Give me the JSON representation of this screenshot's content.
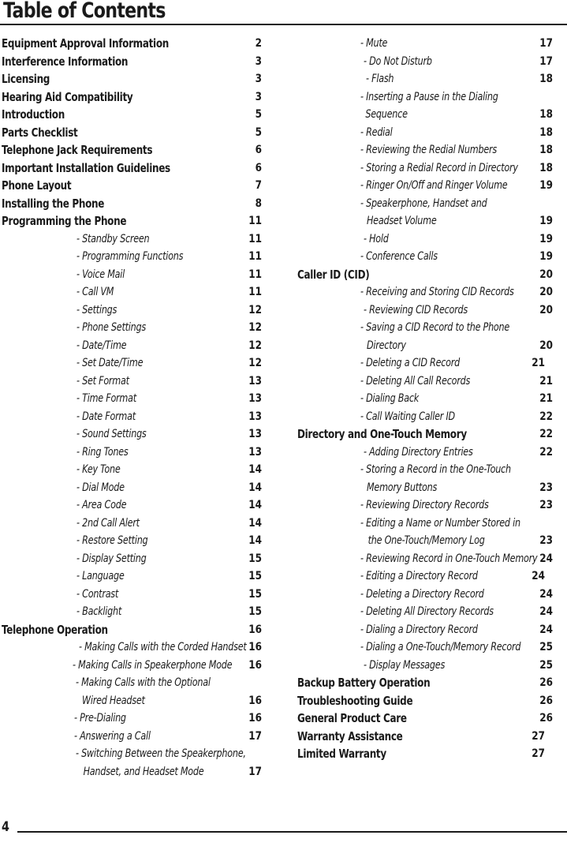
{
  "document": {
    "title": "Table of Contents",
    "folio": "4"
  },
  "columns": [
    {
      "id": "left",
      "entries": [
        {
          "type": "section",
          "label": "Equipment Approval Information",
          "page": "2",
          "indent": 0
        },
        {
          "type": "section",
          "label": "Interference Information",
          "page": "3",
          "indent": 0
        },
        {
          "type": "section",
          "label": "Licensing",
          "page": "3",
          "indent": 0
        },
        {
          "type": "section",
          "label": "Hearing Aid Compatibility",
          "page": "3",
          "indent": 0
        },
        {
          "type": "section",
          "label": "Introduction",
          "page": "5",
          "indent": 0
        },
        {
          "type": "section",
          "label": "Parts Checklist",
          "page": "5",
          "indent": 0
        },
        {
          "type": "section",
          "label": "Telephone Jack Requirements",
          "page": "6",
          "indent": 0
        },
        {
          "type": "section",
          "label": "Important Installation Guidelines",
          "page": "6",
          "indent": 0
        },
        {
          "type": "section",
          "label": "Phone Layout",
          "page": "7",
          "indent": 0
        },
        {
          "type": "section",
          "label": "Installing the Phone",
          "page": "8",
          "indent": 0
        },
        {
          "type": "section",
          "label": "Programming the Phone",
          "page": "11",
          "indent": 0
        },
        {
          "type": "sub",
          "label": "- Standby Screen",
          "page": "11",
          "indent": 95
        },
        {
          "type": "sub",
          "label": "- Programming Functions",
          "page": "11",
          "indent": 95
        },
        {
          "type": "sub",
          "label": "- Voice Mail",
          "page": "11",
          "indent": 95
        },
        {
          "type": "sub",
          "label": "- Call VM",
          "page": "11",
          "indent": 95
        },
        {
          "type": "sub",
          "label": "- Settings",
          "page": "12",
          "indent": 95
        },
        {
          "type": "sub",
          "label": "- Phone Settings",
          "page": "12",
          "indent": 95
        },
        {
          "type": "sub",
          "label": "- Date/Time",
          "page": "12",
          "indent": 95
        },
        {
          "type": "sub",
          "label": "- Set Date/Time",
          "page": "12",
          "indent": 95
        },
        {
          "type": "sub",
          "label": "- Set Format",
          "page": "13",
          "indent": 95
        },
        {
          "type": "sub",
          "label": "- Time Format",
          "page": "13",
          "indent": 95
        },
        {
          "type": "sub",
          "label": "- Date Format",
          "page": "13",
          "indent": 95
        },
        {
          "type": "sub",
          "label": "- Sound Settings",
          "page": "13",
          "indent": 95
        },
        {
          "type": "sub",
          "label": "- Ring Tones",
          "page": "13",
          "indent": 95
        },
        {
          "type": "sub",
          "label": "- Key Tone",
          "page": "14",
          "indent": 95
        },
        {
          "type": "sub",
          "label": "- Dial Mode",
          "page": "14",
          "indent": 95
        },
        {
          "type": "sub",
          "label": "- Area Code",
          "page": "14",
          "indent": 95
        },
        {
          "type": "sub",
          "label": "- 2nd Call Alert",
          "page": "14",
          "indent": 95
        },
        {
          "type": "sub",
          "label": "- Restore Setting",
          "page": "14",
          "indent": 95
        },
        {
          "type": "sub",
          "label": "- Display Setting",
          "page": "15",
          "indent": 95
        },
        {
          "type": "sub",
          "label": "- Language",
          "page": "15",
          "indent": 95
        },
        {
          "type": "sub",
          "label": "- Contrast",
          "page": "15",
          "indent": 95
        },
        {
          "type": "sub",
          "label": "- Backlight",
          "page": "15",
          "indent": 95
        },
        {
          "type": "section",
          "label": "Telephone Operation",
          "page": "16",
          "indent": 0
        },
        {
          "type": "sub",
          "label": "- Making Calls with the Corded Handset",
          "page": "16",
          "indent": 98
        },
        {
          "type": "sub",
          "label": "- Making Calls in Speakerphone  Mode",
          "page": "16",
          "indent": 90
        },
        {
          "type": "sub",
          "label": "- Making Calls with the Optional",
          "label2": "Wired Headset",
          "page": "16",
          "indent": 94,
          "indent2": 104
        },
        {
          "type": "sub",
          "label": "- Pre-Dialing",
          "page": "16",
          "indent": 92
        },
        {
          "type": "sub",
          "label": "- Answering a Call",
          "page": "17",
          "indent": 92
        },
        {
          "type": "sub",
          "label": "- Switching Between the Speakerphone,",
          "label2": "Handset, and Headset Mode",
          "page": "17",
          "indent": 94,
          "indent2": 106
        }
      ]
    },
    {
      "id": "right",
      "entries": [
        {
          "type": "sub",
          "label": "- Mute",
          "page": "17",
          "indent": 88
        },
        {
          "type": "sub",
          "label": "- Do Not Disturb",
          "page": "17",
          "indent": 92
        },
        {
          "type": "sub",
          "label": "- Flash",
          "page": "18",
          "indent": 95
        },
        {
          "type": "sub",
          "label": "- Inserting a Pause in the Dialing",
          "label2": "Sequence",
          "page": "18",
          "indent": 88,
          "indent2": 96
        },
        {
          "type": "sub",
          "label": "- Redial",
          "page": "18",
          "indent": 88
        },
        {
          "type": "sub",
          "label": "- Reviewing the Redial Numbers",
          "page": "18",
          "indent": 88
        },
        {
          "type": "sub",
          "label": "- Storing a Redial Record in Directory",
          "page": "18",
          "indent": 88
        },
        {
          "type": "sub",
          "label": "- Ringer On/Off and Ringer Volume",
          "page": "19",
          "indent": 88
        },
        {
          "type": "sub",
          "label": "- Speakerphone, Handset and",
          "label2": "Headset Volume",
          "page": "19",
          "indent": 88,
          "indent2": 98
        },
        {
          "type": "sub",
          "label": "- Hold",
          "page": "19",
          "indent": 92
        },
        {
          "type": "sub",
          "label": "- Conference Calls",
          "page": "19",
          "indent": 88
        },
        {
          "type": "section",
          "label": "Caller ID (CID)",
          "page": "20",
          "indent": 8
        },
        {
          "type": "sub",
          "label": "- Receiving and Storing CID Records",
          "page": "20",
          "indent": 88
        },
        {
          "type": "sub",
          "label": "- Reviewing CID Records",
          "page": "20",
          "indent": 92
        },
        {
          "type": "sub",
          "label": "- Saving a CID Record to the Phone",
          "label2": "Directory",
          "page": "20",
          "indent": 88,
          "indent2": 98
        },
        {
          "type": "sub",
          "label": "- Deleting a CID Record",
          "page": "21",
          "indent": 88,
          "pagenudge": true
        },
        {
          "type": "sub",
          "label": "- Deleting All Call Records",
          "page": "21",
          "indent": 88
        },
        {
          "type": "sub",
          "label": "- Dialing Back",
          "page": "21",
          "indent": 88
        },
        {
          "type": "sub",
          "label": "- Call Waiting Caller ID",
          "page": "22",
          "indent": 88
        },
        {
          "type": "section",
          "label": "Directory and One-Touch Memory",
          "page": "22",
          "indent": 8
        },
        {
          "type": "sub",
          "label": "- Adding Directory Entries",
          "page": "22",
          "indent": 92
        },
        {
          "type": "sub",
          "label": "- Storing a Record in the One-Touch",
          "label2": "Memory Buttons",
          "page": "23",
          "indent": 88,
          "indent2": 98
        },
        {
          "type": "sub",
          "label": "- Reviewing Directory Records",
          "page": "23",
          "indent": 88
        },
        {
          "type": "sub",
          "label": "- Editing a Name or Number Stored in",
          "label2": "the One-Touch/Memory Log",
          "page": "23",
          "indent": 88,
          "indent2": 100
        },
        {
          "type": "sub",
          "label": "- Reviewing Record in One-Touch Memory",
          "page": "24",
          "indent": 88
        },
        {
          "type": "sub",
          "label": "- Editing a Directory Record",
          "page": "24",
          "indent": 88,
          "pagenudge": true
        },
        {
          "type": "sub",
          "label": "- Deleting a Directory Record",
          "page": "24",
          "indent": 88
        },
        {
          "type": "sub",
          "label": "- Deleting All Directory Records",
          "page": "24",
          "indent": 88
        },
        {
          "type": "sub",
          "label": "- Dialing a Directory Record",
          "page": "24",
          "indent": 88
        },
        {
          "type": "sub",
          "label": "- Dialing a One-Touch/Memory Record",
          "page": "25",
          "indent": 88
        },
        {
          "type": "sub",
          "label": "- Display Messages",
          "page": "25",
          "indent": 92
        },
        {
          "type": "section",
          "label": "Backup Battery Operation",
          "page": "26",
          "indent": 8
        },
        {
          "type": "section",
          "label": "Troubleshooting Guide",
          "page": "26",
          "indent": 8
        },
        {
          "type": "section",
          "label": "General Product Care",
          "page": "26",
          "indent": 8
        },
        {
          "type": "section",
          "label": "Warranty Assistance",
          "page": "27",
          "indent": 8,
          "pagenudge": true
        },
        {
          "type": "section",
          "label": "Limited Warranty",
          "page": "27",
          "indent": 8,
          "pagenudge": true
        }
      ]
    }
  ]
}
